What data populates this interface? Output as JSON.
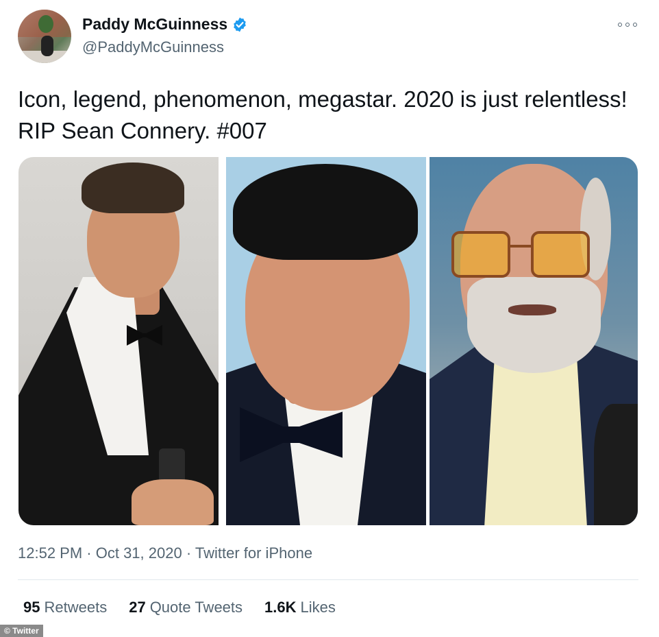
{
  "header": {
    "display_name": "Paddy McGuinness",
    "handle": "@PaddyMcGuinness",
    "verified_icon": "verified-badge-icon",
    "more_icon": "more-options-icon"
  },
  "tweet": {
    "text": "Icon, legend, phenomenon, megastar. 2020 is just relentless! RIP Sean Connery. #007"
  },
  "media": {
    "count": 3
  },
  "meta": {
    "time": "12:52 PM",
    "sep1": " · ",
    "date": "Oct 31, 2020",
    "sep2": " · ",
    "source": "Twitter for iPhone"
  },
  "stats": [
    {
      "count": "95",
      "label": "Retweets"
    },
    {
      "count": "27",
      "label": "Quote Tweets"
    },
    {
      "count": "1.6K",
      "label": "Likes"
    }
  ],
  "watermark": "© Twitter",
  "colors": {
    "accent": "#1d9bf0",
    "secondary_text": "#536471",
    "primary_text": "#0f1419"
  }
}
